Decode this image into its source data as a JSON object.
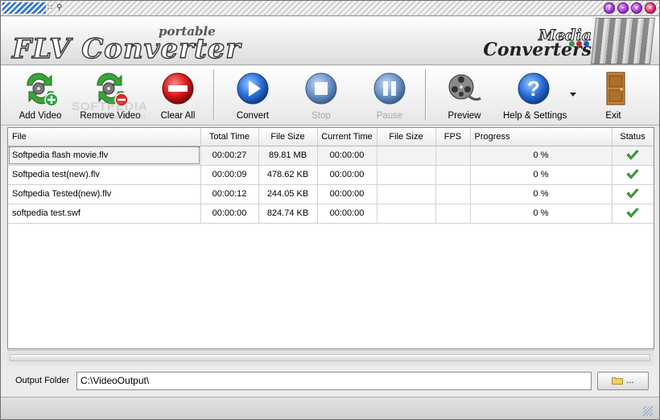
{
  "header": {
    "logo_sub": "portable",
    "logo_main": "FLV Converter",
    "brand_line1": "Media",
    "brand_line2": "Converters",
    "brand_dots": [
      "#2a9d3a",
      "#d11f2a",
      "#2456c9"
    ]
  },
  "toolbar": {
    "add_video": "Add Video",
    "remove_video": "Remove Video",
    "clear_all": "Clear All",
    "convert": "Convert",
    "stop": "Stop",
    "pause": "Pause",
    "preview": "Preview",
    "help_settings": "Help & Settings",
    "exit": "Exit",
    "watermark": "SOFTPEDIA",
    "watermark_sub": "www.softpedia.com"
  },
  "table": {
    "columns": [
      "File",
      "Total Time",
      "File Size",
      "Current Time",
      "File Size",
      "FPS",
      "Progress",
      "Status"
    ],
    "rows": [
      {
        "file": "Softpedia flash movie.flv",
        "total_time": "00:00:27",
        "file_size": "89.81 MB",
        "current_time": "00:00:00",
        "out_size": "",
        "fps": "",
        "progress": "0 %"
      },
      {
        "file": "Softpedia test(new).flv",
        "total_time": "00:00:09",
        "file_size": "478.62 KB",
        "current_time": "00:00:00",
        "out_size": "",
        "fps": "",
        "progress": "0 %"
      },
      {
        "file": "Softpedia Tested(new).flv",
        "total_time": "00:00:12",
        "file_size": "244.05 KB",
        "current_time": "00:00:00",
        "out_size": "",
        "fps": "",
        "progress": "0 %"
      },
      {
        "file": "softpedia test.swf",
        "total_time": "00:00:00",
        "file_size": "824.74 KB",
        "current_time": "00:00:00",
        "out_size": "",
        "fps": "",
        "progress": "0 %"
      }
    ]
  },
  "output": {
    "label": "Output Folder",
    "value": "C:\\VideoOutput\\",
    "browse_label": "..."
  }
}
